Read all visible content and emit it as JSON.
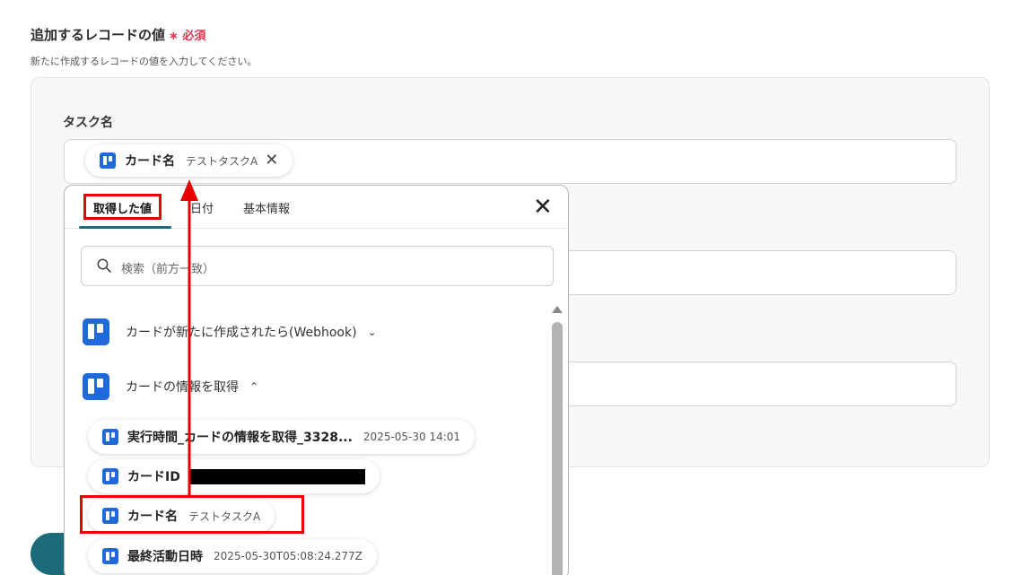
{
  "section": {
    "title": "追加するレコードの値",
    "required_mark": "∗ 必須",
    "description": "新たに作成するレコードの値を入力してください。"
  },
  "fields": [
    {
      "label": "タスク名"
    }
  ],
  "top_chip": {
    "key": "カード名",
    "value": "テストタスクA",
    "remove_icon": "close-icon"
  },
  "popup": {
    "tabs": [
      {
        "label": "取得した値",
        "active": true
      },
      {
        "label": "日付"
      },
      {
        "label": "基本情報"
      }
    ],
    "close_icon": "close-icon",
    "search": {
      "placeholder": "検索（前方一致）",
      "icon": "search-icon"
    },
    "groups": [
      {
        "name": "カードが新たに作成されたら(Webhook)",
        "expanded": false
      },
      {
        "name": "カードの情報を取得",
        "expanded": true
      }
    ],
    "items": [
      {
        "key": "実行時間_カードの情報を取得_3328...",
        "value": "2025-05-30 14:01"
      },
      {
        "key": "カードID",
        "value": ""
      },
      {
        "key": "カード名",
        "value": "テストタスクA"
      },
      {
        "key": "最終活動日時",
        "value": "2025-05-30T05:08:24.277Z"
      }
    ]
  },
  "colors": {
    "accent": "#1b6b7a",
    "required": "#e0344a",
    "highlight": "#e60000",
    "logo": "#1f6ad8"
  }
}
